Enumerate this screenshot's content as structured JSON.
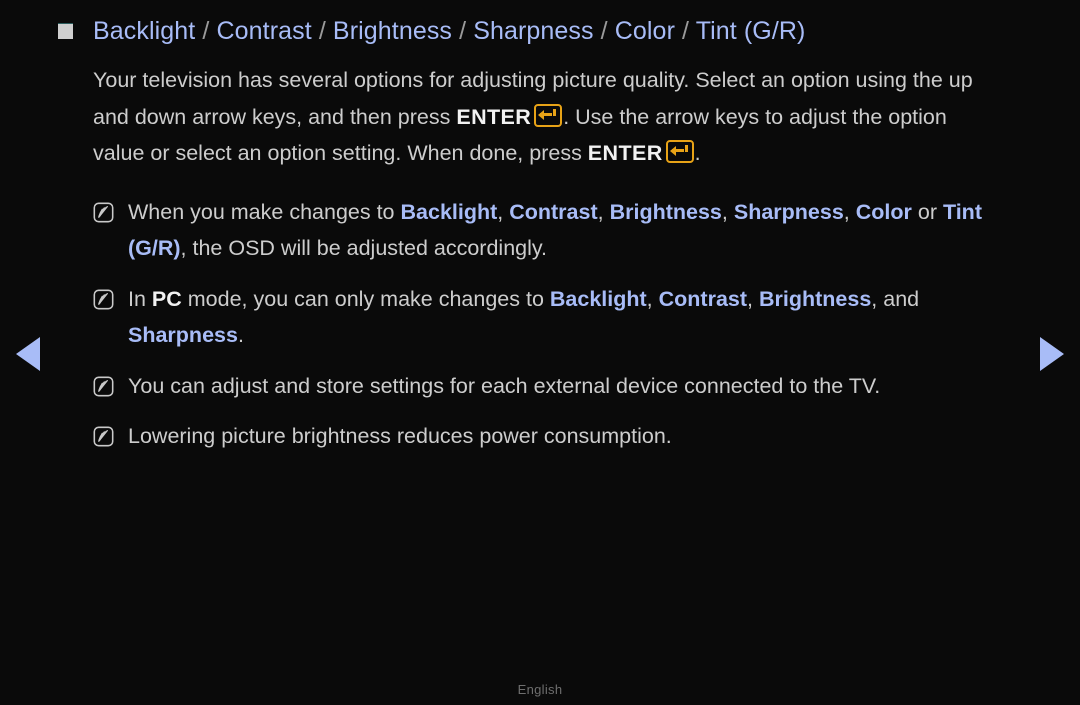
{
  "background_color": "#0a0a0a",
  "accent_blue": "#a8bcf7",
  "body_text_color": "#cdcdcd",
  "enter_key_color": "#e8a317",
  "heading": {
    "bullet": "square-bullet",
    "segments": [
      {
        "text": "Backlight",
        "style": "keyword"
      },
      {
        "text": " / ",
        "style": "separator"
      },
      {
        "text": "Contrast",
        "style": "keyword"
      },
      {
        "text": " / ",
        "style": "separator"
      },
      {
        "text": "Brightness",
        "style": "keyword"
      },
      {
        "text": " / ",
        "style": "separator"
      },
      {
        "text": "Sharpness",
        "style": "keyword"
      },
      {
        "text": " / ",
        "style": "separator"
      },
      {
        "text": "Color",
        "style": "keyword"
      },
      {
        "text": " / ",
        "style": "separator"
      },
      {
        "text": "Tint (G/R)",
        "style": "keyword"
      }
    ],
    "plain_text": "Backlight / Contrast / Brightness / Sharpness / Color / Tint (G/R)"
  },
  "intro": {
    "part1": "Your television has several options for adjusting picture quality. Select an option using the up and down arrow keys, and then press ",
    "enter1": "ENTER",
    "part2": ". Use the arrow keys to adjust the option value or select an option setting. When done, press ",
    "enter2": "ENTER",
    "part3": ".",
    "full_text": "Your television has several options for adjusting picture quality. Select an option using the up and down arrow keys, and then press ENTER. Use the arrow keys to adjust the option value or select an option setting. When done, press ENTER."
  },
  "notes": [
    {
      "icon": "note-icon",
      "full_text": "When you make changes to Backlight, Contrast, Brightness, Sharpness, Color or Tint (G/R), the OSD will be adjusted accordingly.",
      "segments": [
        {
          "text": "When you make changes to ",
          "style": "plain"
        },
        {
          "text": "Backlight",
          "style": "keyword"
        },
        {
          "text": ", ",
          "style": "plain"
        },
        {
          "text": "Contrast",
          "style": "keyword"
        },
        {
          "text": ", ",
          "style": "plain"
        },
        {
          "text": "Brightness",
          "style": "keyword"
        },
        {
          "text": ", ",
          "style": "plain"
        },
        {
          "text": "Sharpness",
          "style": "keyword"
        },
        {
          "text": ", ",
          "style": "plain"
        },
        {
          "text": "Color",
          "style": "keyword"
        },
        {
          "text": " or ",
          "style": "plain"
        },
        {
          "text": "Tint (G/R)",
          "style": "keyword"
        },
        {
          "text": ", the OSD will be adjusted accordingly.",
          "style": "plain"
        }
      ]
    },
    {
      "icon": "note-icon",
      "full_text": "In PC mode, you can only make changes to Backlight, Contrast, Brightness, and Sharpness.",
      "segments": [
        {
          "text": "In ",
          "style": "plain"
        },
        {
          "text": "PC",
          "style": "keyword-white"
        },
        {
          "text": " mode, you can only make changes to ",
          "style": "plain"
        },
        {
          "text": "Backlight",
          "style": "keyword"
        },
        {
          "text": ", ",
          "style": "plain"
        },
        {
          "text": "Contrast",
          "style": "keyword"
        },
        {
          "text": ", ",
          "style": "plain"
        },
        {
          "text": "Brightness",
          "style": "keyword"
        },
        {
          "text": ", and ",
          "style": "plain"
        },
        {
          "text": "Sharpness",
          "style": "keyword"
        },
        {
          "text": ".",
          "style": "plain"
        }
      ]
    },
    {
      "icon": "note-icon",
      "full_text": "You can adjust and store settings for each external device connected to the TV.",
      "segments": [
        {
          "text": "You can adjust and store settings for each external device connected to the TV.",
          "style": "plain"
        }
      ]
    },
    {
      "icon": "note-icon",
      "full_text": "Lowering picture brightness reduces power consumption.",
      "segments": [
        {
          "text": "Lowering picture brightness reduces power consumption.",
          "style": "plain"
        }
      ]
    }
  ],
  "navigation": {
    "prev_label": "previous-page",
    "next_label": "next-page",
    "prev_icon": "triangle-left-icon",
    "next_icon": "triangle-right-icon"
  },
  "footer": {
    "language": "English"
  }
}
